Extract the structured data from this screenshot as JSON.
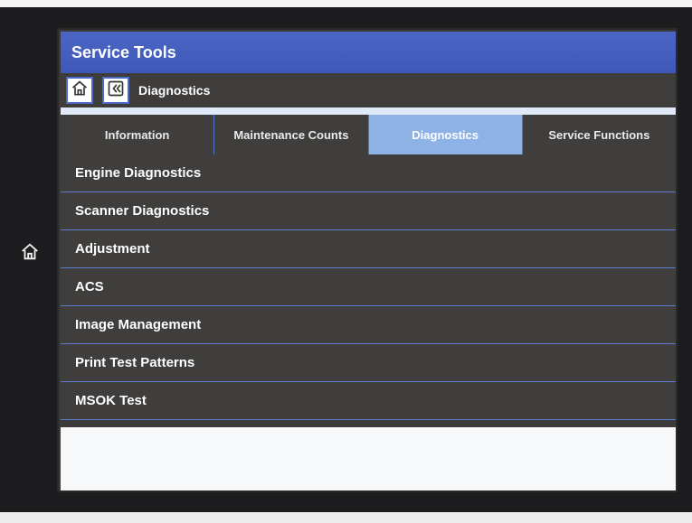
{
  "app": {
    "title": "Service Tools"
  },
  "nav": {
    "breadcrumb": "Diagnostics"
  },
  "tabs": [
    {
      "label": "Information",
      "active": false
    },
    {
      "label": "Maintenance Counts",
      "active": false
    },
    {
      "label": "Diagnostics",
      "active": true
    },
    {
      "label": "Service Functions",
      "active": false
    }
  ],
  "menu": {
    "items": [
      {
        "label": "Engine Diagnostics"
      },
      {
        "label": "Scanner Diagnostics"
      },
      {
        "label": "Adjustment"
      },
      {
        "label": "ACS"
      },
      {
        "label": "Image Management"
      },
      {
        "label": "Print Test Patterns"
      },
      {
        "label": "MSOK Test"
      }
    ]
  },
  "colors": {
    "title_bar": "#4b66c4",
    "active_tab": "#8db3e6",
    "row_bg": "#3f3e3c",
    "divider": "#5b7ccc"
  },
  "icons": {
    "device_home": "home-icon",
    "nav_home": "home-icon",
    "nav_back": "back-icon"
  }
}
